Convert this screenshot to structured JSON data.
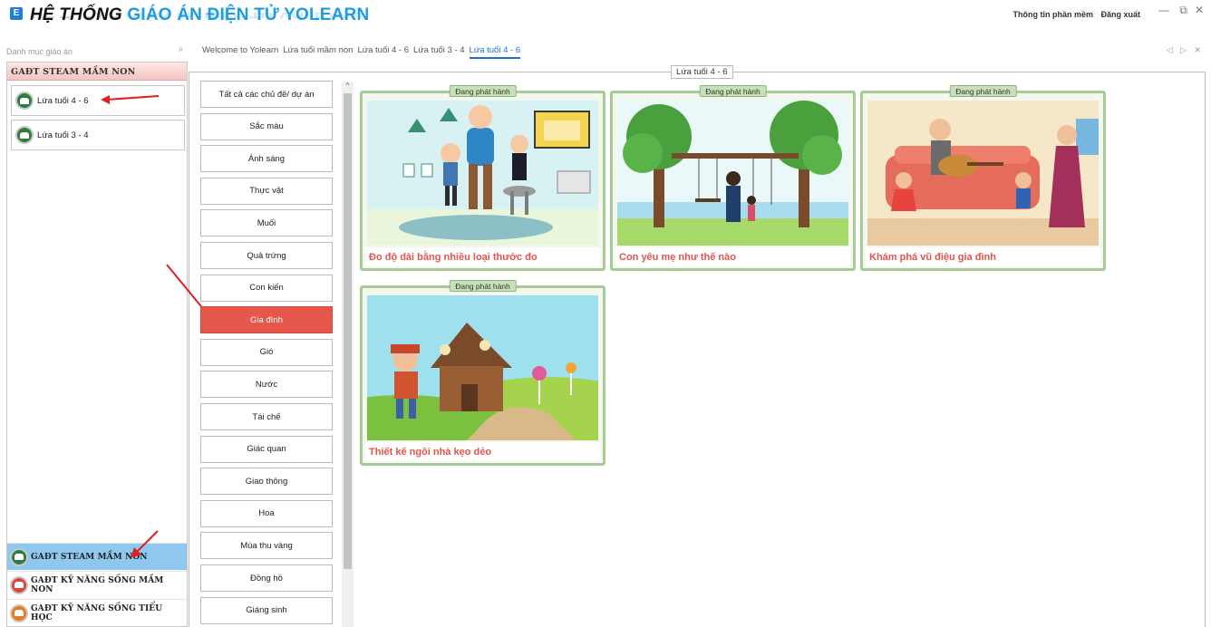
{
  "title": {
    "part1": "HỆ THỐNG",
    "part2": "GIÁO ÁN ĐIỆN TỬ YOLEARN"
  },
  "top_links": [
    "Thông tin phần mềm",
    "Đăng xuất"
  ],
  "window_controls": {
    "minimize": "—",
    "restore": "⧉",
    "close": "✕"
  },
  "left_panel": {
    "caption": "Danh mục giáo án",
    "pin": "ᵖ",
    "group_header": "GAĐT STEAM MẦM NON",
    "age_groups": [
      {
        "label": "Lứa tuổi 4 - 6"
      },
      {
        "label": "Lứa tuổi 3 - 4"
      }
    ],
    "grip": "........",
    "nav": [
      {
        "label": "GAĐT STEAM MẦM NON",
        "color": "#2e7d3e"
      },
      {
        "label": "GAĐT KỸ NĂNG SỐNG MẦM NON",
        "color": "#d9463c"
      },
      {
        "label": "GAĐT KỸ NĂNG SỐNG TIỂU HỌC",
        "color": "#e57a1f"
      }
    ]
  },
  "tabs": [
    "Welcome to Yolearn",
    "Lứa tuổi mầm non",
    "Lứa tuổi 4 - 6",
    "Lứa tuổi 3 - 4",
    "Lứa tuổi 4 - 6"
  ],
  "tab_arrows": "◁ ▷ ✕",
  "content_legend": "Lứa tuổi 4 - 6",
  "scroll_up": "^",
  "topics": [
    "Tất cả các chủ đề/ dự án",
    "Sắc màu",
    "Ánh sáng",
    "Thực vật",
    "Muối",
    "Quả trứng",
    "Con kiến",
    "Gia đình",
    "Gió",
    "Nước",
    "Tái chế",
    "Giác quan",
    "Giao thông",
    "Hoa",
    "Mùa thu vàng",
    "Đồng hồ",
    "Giáng sinh"
  ],
  "cards": [
    {
      "badge": "Đang phát hành",
      "caption": "Đo độ dài bằng nhiều loại thước đo",
      "icon": "measuring-lesson-illustration"
    },
    {
      "badge": "Đang phát hành",
      "caption": "Con yêu mẹ như thế nào",
      "icon": "mother-child-swing-illustration"
    },
    {
      "badge": "Đang phát hành",
      "caption": "Khám phá vũ điệu gia đình",
      "icon": "family-dance-illustration"
    },
    {
      "badge": "Đang phát hành",
      "caption": "Thiết kế ngôi nhà kẹo dẻo",
      "icon": "candy-house-illustration"
    }
  ],
  "colors": {
    "accent_blue": "#1f9be0",
    "active_topic": "#e5574a",
    "card_border": "#a8c998",
    "caption_text": "#e4544a",
    "nav_selected": "#8ec8ee"
  }
}
